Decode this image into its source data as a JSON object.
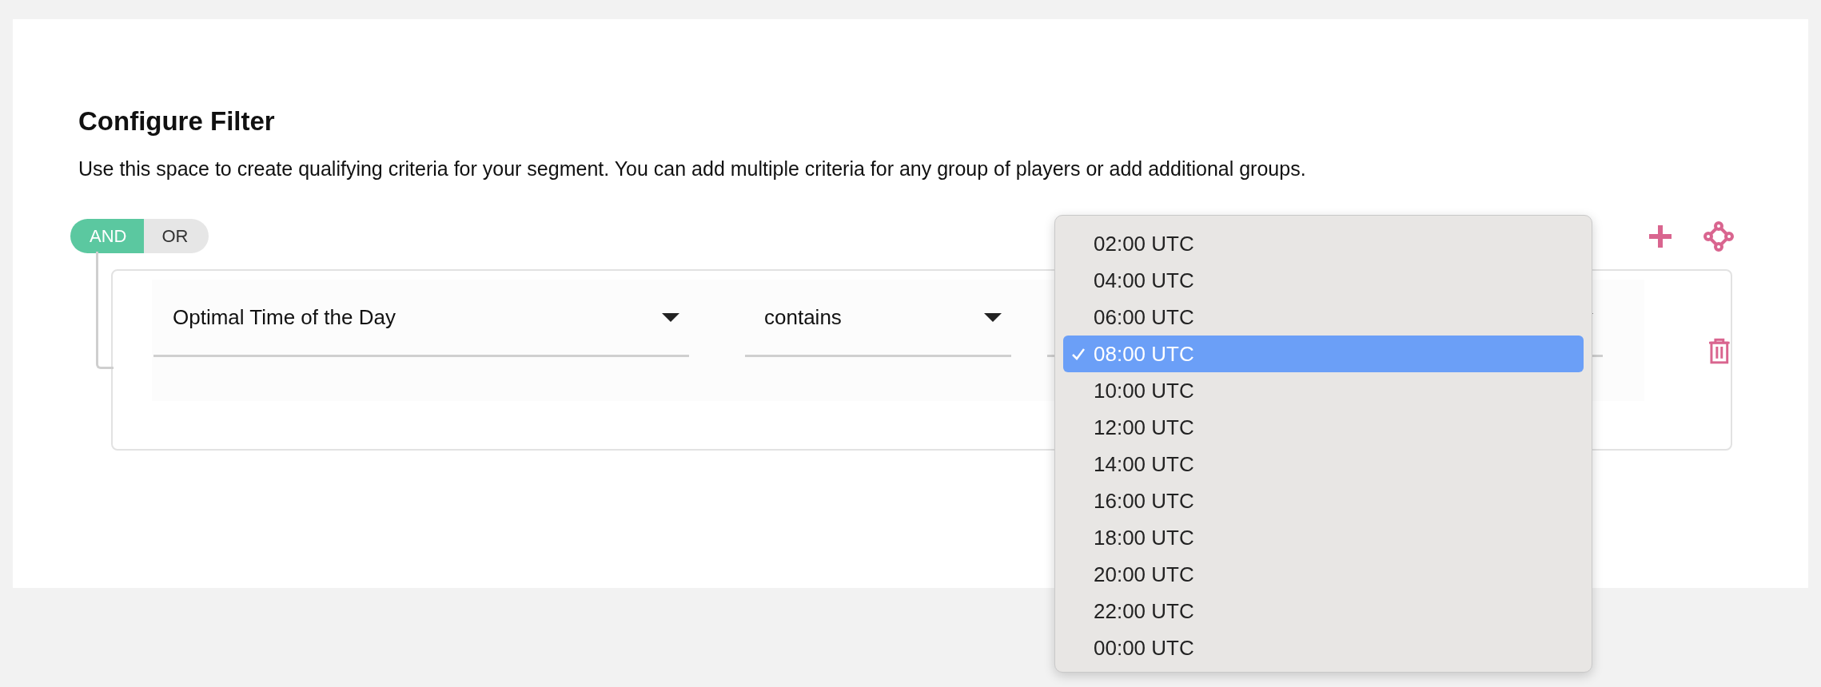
{
  "title": "Configure Filter",
  "description": "Use this space to create qualifying criteria for your segment. You can add multiple criteria for any group of players or add additional groups.",
  "logic_toggle": [
    {
      "label": "AND",
      "selected": true
    },
    {
      "label": "OR",
      "selected": false
    }
  ],
  "criteria": [
    {
      "field": "Optimal Time of the Day",
      "operator": "contains"
    }
  ],
  "dropdown": {
    "options": [
      {
        "label": "02:00 UTC",
        "selected": false
      },
      {
        "label": "04:00 UTC",
        "selected": false
      },
      {
        "label": "06:00 UTC",
        "selected": false
      },
      {
        "label": "08:00 UTC",
        "selected": true
      },
      {
        "label": "10:00 UTC",
        "selected": false
      },
      {
        "label": "12:00 UTC",
        "selected": false
      },
      {
        "label": "14:00 UTC",
        "selected": false
      },
      {
        "label": "16:00 UTC",
        "selected": false
      },
      {
        "label": "18:00 UTC",
        "selected": false
      },
      {
        "label": "20:00 UTC",
        "selected": false
      },
      {
        "label": "22:00 UTC",
        "selected": false
      },
      {
        "label": "00:00 UTC",
        "selected": false
      }
    ]
  }
}
